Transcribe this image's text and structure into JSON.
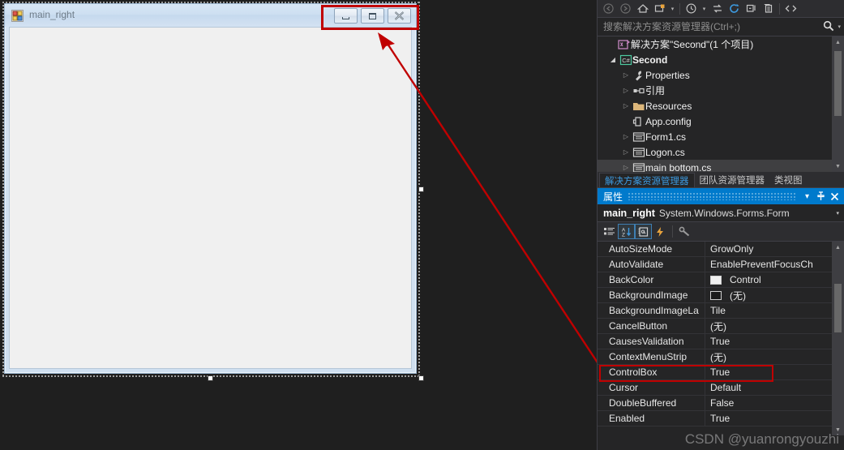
{
  "designer": {
    "form": {
      "title": "main_right",
      "icon": "windows-form-icon",
      "window_buttons": [
        {
          "name": "minimize",
          "glyph": "minimize-icon"
        },
        {
          "name": "maximize",
          "glyph": "maximize-icon"
        },
        {
          "name": "close",
          "glyph": "close-icon"
        }
      ]
    },
    "annotation": {
      "highlight_color": "#c00000",
      "arrow_color": "#c00000"
    }
  },
  "solution_explorer": {
    "toolbar": [
      {
        "name": "back-icon",
        "glyph": "←"
      },
      {
        "name": "forward-icon",
        "glyph": "→"
      },
      {
        "name": "home-icon",
        "glyph": "⌂"
      },
      {
        "name": "pending-changes-icon",
        "glyph": "◰"
      },
      {
        "name": "toolbar-dropdown-caret",
        "glyph": "▾"
      },
      {
        "name": "history-icon",
        "glyph": "◴"
      },
      {
        "name": "history-caret",
        "glyph": "▾"
      },
      {
        "name": "sync-with-active-document-icon",
        "glyph": "⇄"
      },
      {
        "name": "refresh-icon",
        "glyph": "↻"
      },
      {
        "name": "collapse-all-icon",
        "glyph": "❐"
      },
      {
        "name": "show-all-files-icon",
        "glyph": "⎘"
      },
      {
        "name": "view-code-icon",
        "glyph": "‹›"
      }
    ],
    "search": {
      "placeholder": "搜索解决方案资源管理器(Ctrl+;)",
      "value": "",
      "icon": "search-icon",
      "caret": "▾"
    },
    "tree": [
      {
        "label": "解决方案\"Second\"(1 个项目)",
        "indent": 0,
        "twisty": "none",
        "icon": "solution-icon",
        "bold": false,
        "selected": false
      },
      {
        "label": "Second",
        "indent": 1,
        "twisty": "open",
        "icon": "csharp-project-icon",
        "bold": true,
        "selected": false
      },
      {
        "label": "Properties",
        "indent": 2,
        "twisty": "closed",
        "icon": "wrench-icon",
        "bold": false,
        "selected": false
      },
      {
        "label": "引用",
        "indent": 2,
        "twisty": "closed",
        "icon": "references-icon",
        "bold": false,
        "selected": false
      },
      {
        "label": "Resources",
        "indent": 2,
        "twisty": "closed",
        "icon": "folder-icon",
        "bold": false,
        "selected": false
      },
      {
        "label": "App.config",
        "indent": 2,
        "twisty": "none",
        "icon": "config-file-icon",
        "bold": false,
        "selected": false
      },
      {
        "label": "Form1.cs",
        "indent": 2,
        "twisty": "closed",
        "icon": "form-file-icon",
        "bold": false,
        "selected": false
      },
      {
        "label": "Logon.cs",
        "indent": 2,
        "twisty": "closed",
        "icon": "form-file-icon",
        "bold": false,
        "selected": false
      },
      {
        "label": "main bottom.cs",
        "indent": 2,
        "twisty": "closed",
        "icon": "form-file-icon",
        "bold": false,
        "selected": true
      }
    ],
    "tabs": [
      {
        "label": "解决方案资源管理器",
        "active": true
      },
      {
        "label": "团队资源管理器",
        "active": false
      },
      {
        "label": "类视图",
        "active": false
      }
    ]
  },
  "properties_window": {
    "header": {
      "title": "属性",
      "accent_color": "#007acc",
      "buttons": [
        {
          "name": "dropdown",
          "glyph": "▾"
        },
        {
          "name": "pin",
          "glyph": "⏐"
        },
        {
          "name": "close",
          "glyph": "✕"
        }
      ]
    },
    "object": {
      "name": "main_right",
      "type": "System.Windows.Forms.Form",
      "caret": "▾"
    },
    "toolbar": [
      {
        "name": "categorized-icon",
        "glyph": "categorized",
        "toggled": false
      },
      {
        "name": "alphabetical-icon",
        "glyph": "alphabetical",
        "toggled": true
      },
      {
        "name": "properties-icon",
        "glyph": "properties",
        "toggled": true
      },
      {
        "name": "events-icon",
        "glyph": "events",
        "toggled": false
      },
      {
        "name": "property-pages-icon",
        "glyph": "property-pages",
        "toggled": false
      }
    ],
    "rows": [
      {
        "name": "AutoSizeMode",
        "value": "GrowOnly",
        "swatch": null,
        "highlighted": false
      },
      {
        "name": "AutoValidate",
        "value": "EnablePreventFocusCh",
        "swatch": null,
        "highlighted": false
      },
      {
        "name": "BackColor",
        "value": "Control",
        "swatch": "#f0f0f0",
        "highlighted": false
      },
      {
        "name": "BackgroundImage",
        "value": "(无)",
        "swatch": "#1b1b1b",
        "highlighted": false
      },
      {
        "name": "BackgroundImageLa",
        "value": "Tile",
        "swatch": null,
        "highlighted": false
      },
      {
        "name": "CancelButton",
        "value": "(无)",
        "swatch": null,
        "highlighted": false
      },
      {
        "name": "CausesValidation",
        "value": "True",
        "swatch": null,
        "highlighted": false
      },
      {
        "name": "ContextMenuStrip",
        "value": "(无)",
        "swatch": null,
        "highlighted": false
      },
      {
        "name": "ControlBox",
        "value": "True",
        "swatch": null,
        "highlighted": true
      },
      {
        "name": "Cursor",
        "value": "Default",
        "swatch": null,
        "highlighted": false
      },
      {
        "name": "DoubleBuffered",
        "value": "False",
        "swatch": null,
        "highlighted": false
      },
      {
        "name": "Enabled",
        "value": "True",
        "swatch": null,
        "highlighted": false
      }
    ]
  },
  "watermark": "CSDN @yuanrongyouzhi"
}
